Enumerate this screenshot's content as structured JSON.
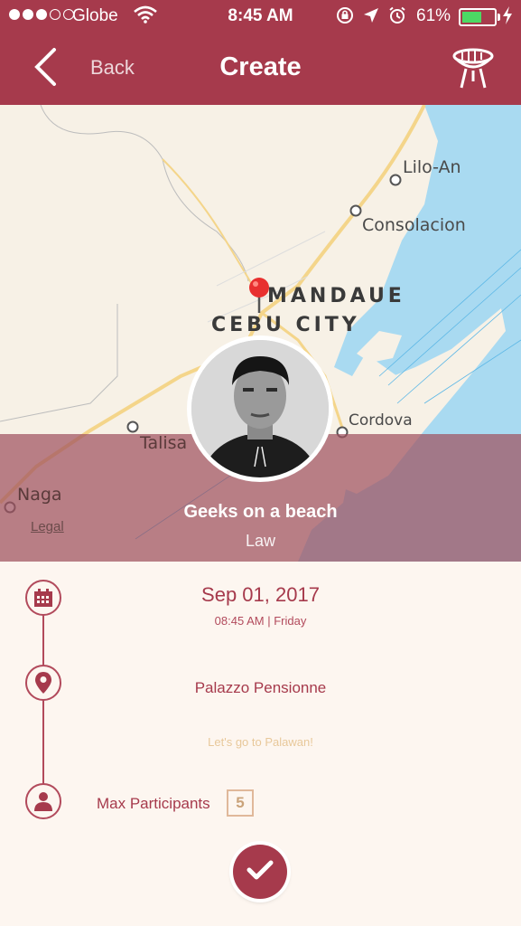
{
  "status_bar": {
    "carrier": "Globe",
    "time": "8:45 AM",
    "battery_percent": "61%",
    "battery_level": 0.61,
    "battery_color": "#4cd964"
  },
  "nav": {
    "back_label": "Back",
    "title": "Create",
    "right_icon": "grill-icon",
    "background_color": "#a63a4c"
  },
  "map": {
    "labels": {
      "lilo_an": "Lilo-An",
      "consolacion": "Consolacion",
      "mandaue": "MANDAUE",
      "cebu_city": "CEBU CITY",
      "cordova": "Cordova",
      "talisay": "Talisa",
      "naga": "Naga"
    },
    "legal": "Legal",
    "pin_icon": "map-pin-icon"
  },
  "group": {
    "name": "Geeks on a beach",
    "category": "Law"
  },
  "event": {
    "date": "Sep 01, 2017",
    "time_info": "08:45 AM | Friday",
    "venue": "Palazzo Pensionne",
    "description": "Let's go to Palawan!",
    "max_participants_label": "Max Participants",
    "max_participants_value": "5"
  },
  "actions": {
    "confirm_icon": "checkmark-icon"
  }
}
